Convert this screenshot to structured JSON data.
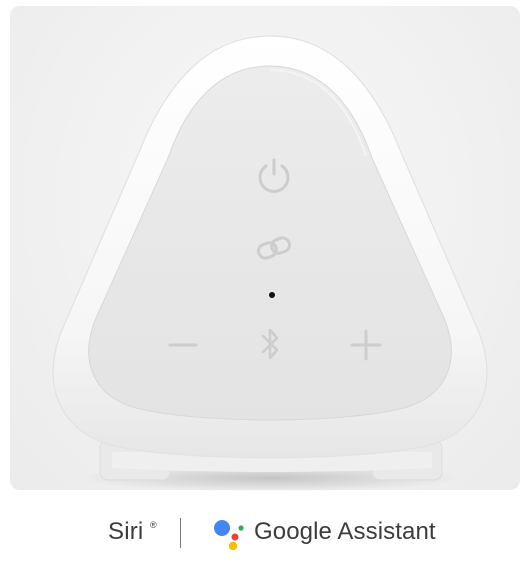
{
  "product": {
    "subject": "white triangular smart speaker, top view",
    "buttons": [
      {
        "name": "power",
        "icon": "power-icon"
      },
      {
        "name": "link",
        "icon": "link-icon"
      },
      {
        "name": "volume-down",
        "icon": "minus-icon"
      },
      {
        "name": "bluetooth",
        "icon": "bluetooth-icon"
      },
      {
        "name": "volume-up",
        "icon": "plus-icon"
      }
    ],
    "colors": {
      "background": "#f1f1f1",
      "body": "#fafafa",
      "top_panel": "#e9e9e9",
      "icon_gray": "#c9c9c9",
      "led": "#111111"
    }
  },
  "brands": {
    "siri_label": "Siri",
    "siri_mark": "®",
    "assistant_label": "Google Assistant",
    "assistant_colors": [
      "#4285F4",
      "#EA4335",
      "#FBBC05",
      "#34A853"
    ]
  }
}
